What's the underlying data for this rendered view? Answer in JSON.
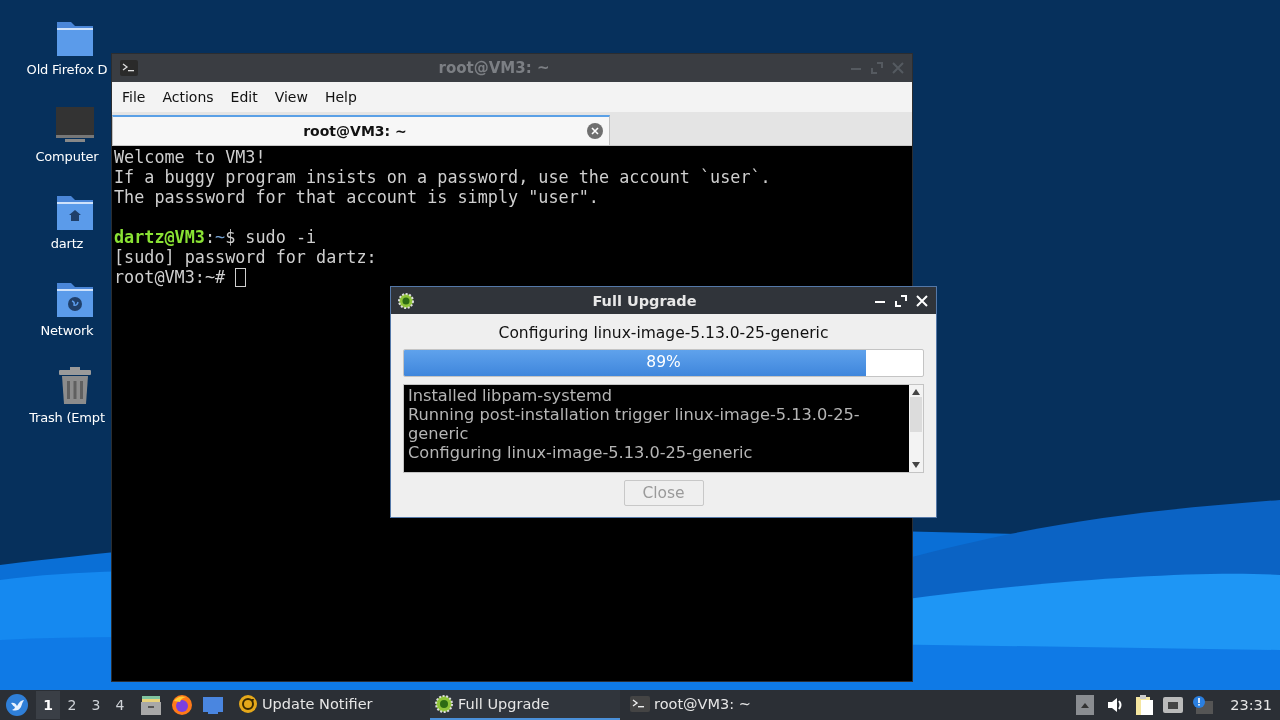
{
  "desktop_icons": [
    {
      "label": "Old Firefox D",
      "kind": "folder"
    },
    {
      "label": "Computer",
      "kind": "computer"
    },
    {
      "label": "dartz",
      "kind": "home"
    },
    {
      "label": "Network",
      "kind": "network"
    },
    {
      "label": "Trash (Empt",
      "kind": "trash"
    }
  ],
  "terminal": {
    "title": "root@VM3: ~",
    "menu": [
      "File",
      "Actions",
      "Edit",
      "View",
      "Help"
    ],
    "tabs": [
      {
        "label": "root@VM3: ~",
        "selected": true
      }
    ],
    "lines": [
      {
        "kind": "text",
        "segments": [
          {
            "text": "Welcome to VM3!",
            "kind": "plain"
          }
        ]
      },
      {
        "kind": "text",
        "segments": [
          {
            "text": "If a buggy program insists on a password, use the account `user`.",
            "kind": "plain"
          }
        ]
      },
      {
        "kind": "text",
        "segments": [
          {
            "text": "The passsword for that account is simply \"user\".",
            "kind": "plain"
          }
        ]
      },
      {
        "kind": "blank"
      },
      {
        "kind": "text",
        "segments": [
          {
            "text": "dartz@VM3",
            "kind": "user"
          },
          {
            "text": ":",
            "kind": "plain"
          },
          {
            "text": "~",
            "kind": "path"
          },
          {
            "text": "$ sudo -i",
            "kind": "plain"
          }
        ]
      },
      {
        "kind": "text",
        "segments": [
          {
            "text": "[sudo] password for dartz:",
            "kind": "plain"
          }
        ]
      },
      {
        "kind": "text",
        "segments": [
          {
            "text": "root@VM3:~# ",
            "kind": "plain"
          }
        ]
      }
    ]
  },
  "dialog": {
    "title": "Full Upgrade",
    "status": "Configuring linux-image-5.13.0-25-generic",
    "progress": {
      "level": 0.89,
      "reading": "89%"
    },
    "log": [
      "Installed libpam-systemd",
      "Running post-installation trigger linux-image-5.13.0-25-generic",
      "Configuring linux-image-5.13.0-25-generic"
    ],
    "button": {
      "label": "Close",
      "disabled": true
    }
  },
  "taskbar": {
    "workspaces": [
      {
        "label": "1",
        "selected": true
      },
      {
        "label": "2",
        "selected": false
      },
      {
        "label": "3",
        "selected": false
      },
      {
        "label": "4",
        "selected": false
      }
    ],
    "launchers": [
      {
        "kind": "files"
      },
      {
        "kind": "browser"
      },
      {
        "kind": "desktop"
      }
    ],
    "tasks": [
      {
        "label": "Update Notifier",
        "kind": "notifier",
        "selected": false
      },
      {
        "label": "Full Upgrade",
        "kind": "upgrade",
        "selected": true
      },
      {
        "label": "root@VM3: ~",
        "kind": "terminal",
        "selected": false
      }
    ],
    "clock": "23:31"
  }
}
